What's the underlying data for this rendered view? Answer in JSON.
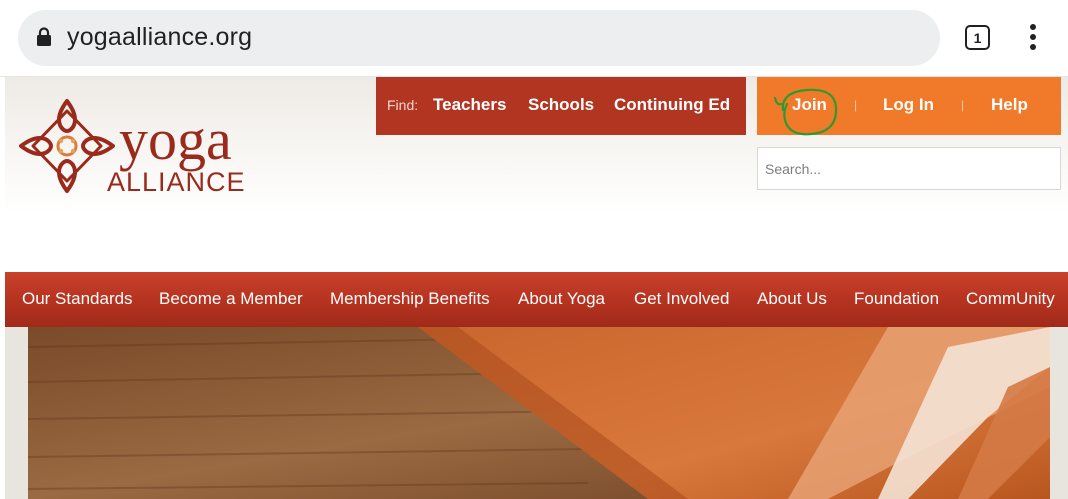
{
  "browser": {
    "url": "yogaalliance.org",
    "tab_count": "1",
    "icons": {
      "lock": "lock-icon",
      "tabs": "tab-switcher-icon",
      "menu": "more-vert-icon"
    }
  },
  "logo": {
    "word1": "yoga",
    "word2": "ALLIANCE"
  },
  "find": {
    "label": "Find:",
    "links": [
      "Teachers",
      "Schools",
      "Continuing Ed"
    ]
  },
  "account": {
    "join": "Join",
    "login": "Log In",
    "help": "Help",
    "separator": "|"
  },
  "search": {
    "placeholder": "Search..."
  },
  "nav": {
    "items": [
      "Our Standards",
      "Become a Member",
      "Membership Benefits",
      "About Yoga",
      "Get Involved",
      "About Us",
      "Foundation",
      "CommUnity"
    ]
  },
  "colors": {
    "find_bar": "#b23522",
    "account_bar": "#f07a2a",
    "nav_bar": "#b3311f",
    "logo": "#9a2a1c",
    "annotation": "#2e9a2e"
  }
}
